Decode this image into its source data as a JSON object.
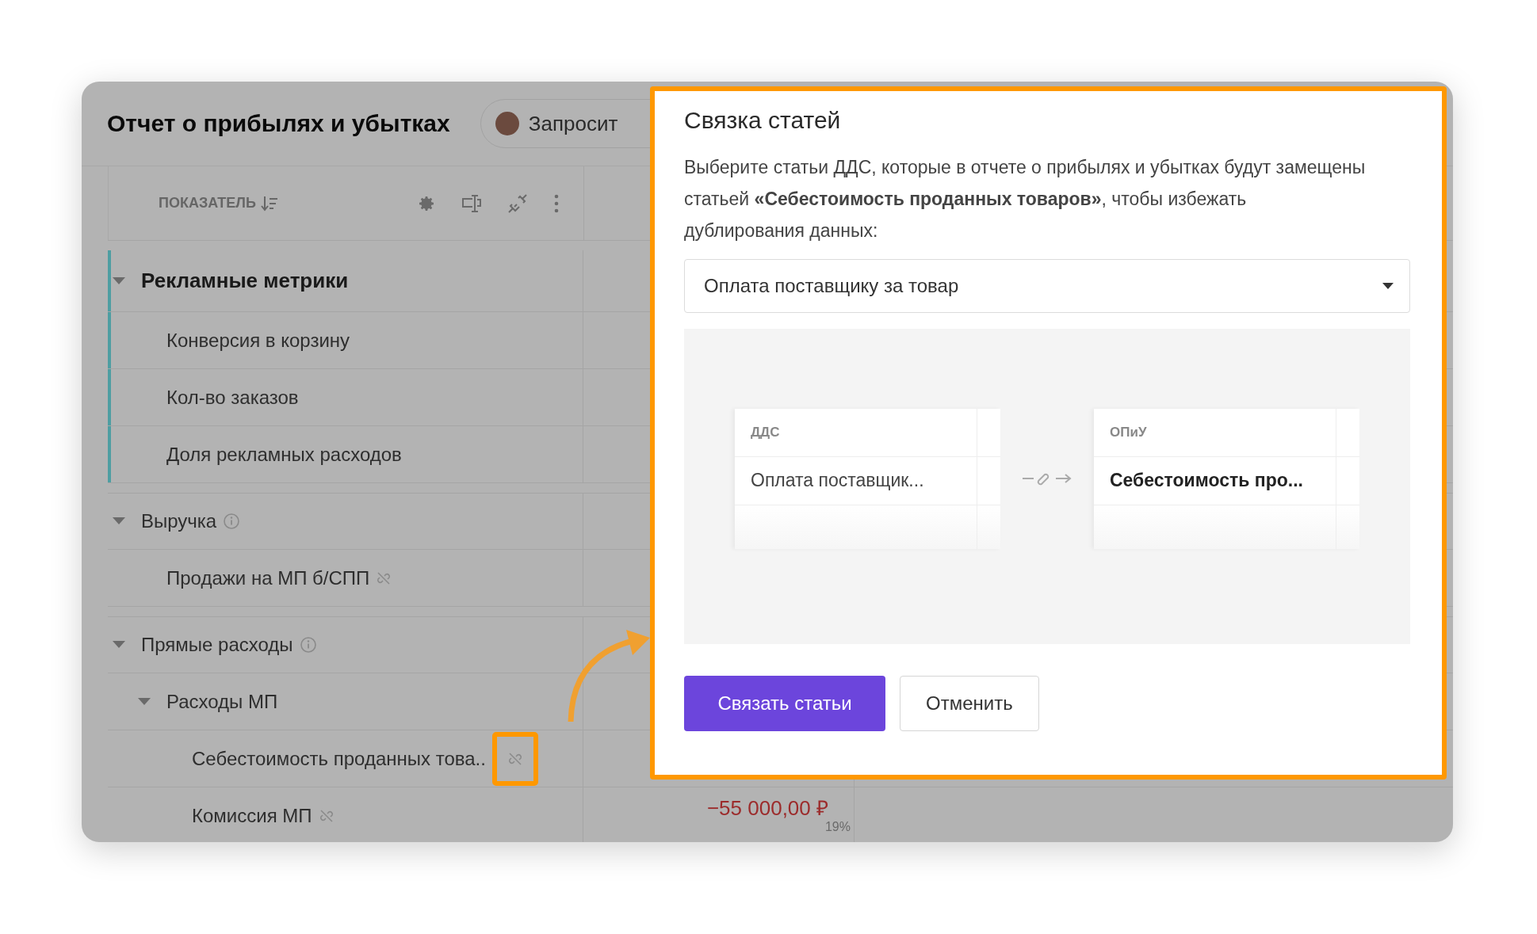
{
  "report": {
    "title": "Отчет о прибылях и убытках",
    "request_button": "Запросит"
  },
  "table": {
    "header": "ПОКАЗАТЕЛЬ",
    "rows": [
      {
        "label": "Рекламные метрики",
        "kind": "section",
        "expanded": true,
        "info": false,
        "children": [
          {
            "label": "Конверсия в корзину",
            "linked": false,
            "highlighted": false
          },
          {
            "label": "Кол-во заказов",
            "linked": false,
            "highlighted": false
          },
          {
            "label": "Доля рекламных расходов",
            "linked": false,
            "highlighted": false
          }
        ]
      },
      {
        "label": "Выручка",
        "kind": "group",
        "expanded": true,
        "info": true,
        "children": [
          {
            "label": "Продажи на МП б/СПП",
            "linked": true,
            "highlighted": false
          }
        ]
      },
      {
        "label": "Прямые расходы",
        "kind": "group",
        "expanded": true,
        "info": true,
        "children": [
          {
            "label": "Расходы МП",
            "kind": "group",
            "expanded": true,
            "info": false,
            "children": [
              {
                "label": "Себестоимость проданных това..",
                "linked": true,
                "highlighted": true
              },
              {
                "label": "Комиссия МП",
                "linked": true,
                "highlighted": false,
                "value": "−55 000,00 ₽",
                "share": "19%"
              }
            ]
          }
        ]
      }
    ]
  },
  "dialog": {
    "title": "Связка статей",
    "text": "Выберите статьи ДДС, которые в отчете о прибылях и убытках будут замещены статьей **«Себестоимость проданных товаров»**, чтобы избежать дублирования данных:",
    "select_value": "Оплата поставщику за товар",
    "mapping": {
      "source": {
        "header": "ДДС",
        "value": "Оплата поставщик..."
      },
      "target": {
        "header": "ОПиУ",
        "value": "Себестоимость про..."
      }
    },
    "buttons": [
      {
        "label": "Связать статьи",
        "kind": "primary"
      },
      {
        "label": "Отменить",
        "kind": "secondary"
      }
    ]
  }
}
